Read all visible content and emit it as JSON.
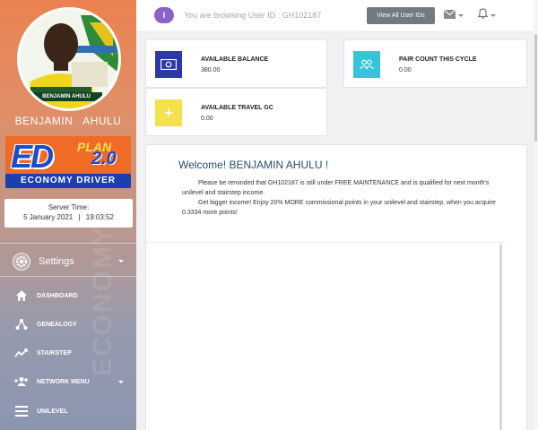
{
  "sidebar": {
    "user_name": "BENJAMIN   AHULU",
    "avatar_caption": "BENJAMIN AHULU",
    "logo": {
      "main": "ED",
      "plan": "PLAN",
      "version": "2.0",
      "tagline": "ECONOMY DRIVER"
    },
    "watermark": "ECONOMY",
    "server": {
      "label": "Server Time:",
      "date": "5 January 2021",
      "separator": "|",
      "time": "19:03:52"
    },
    "settings_label": "Settings",
    "menu": [
      {
        "label": "DASHBOARD",
        "icon": "home-icon"
      },
      {
        "label": "GENEALOGY",
        "icon": "sitemap-icon"
      },
      {
        "label": "STAIRSTEP",
        "icon": "line-chart-icon"
      },
      {
        "label": "NETWORK MENU",
        "icon": "users-plus-icon"
      },
      {
        "label": "UNILEVEL",
        "icon": "list-icon"
      }
    ]
  },
  "topbar": {
    "badge": "I",
    "browsing_text": "You are browsing User ID : GH102187",
    "view_all_button": "View All User IDs"
  },
  "cards": [
    {
      "title": "AVAILABLE BALANCE",
      "value": "380.00",
      "icon": "money-icon",
      "color": "#2d38a8"
    },
    {
      "title": "PAIR COUNT THIS CYCLE",
      "value": "0.00",
      "icon": "group-icon",
      "color": "#35c4dc"
    },
    {
      "title": "AVAILABLE TRAVEL GC",
      "value": "0.00",
      "icon": "plane-icon",
      "color": "#f5e14b"
    }
  ],
  "welcome": {
    "title": "Welcome! BENJAMIN AHULU !",
    "paragraph_1": "Please be reminded that GH102187  is still under FREE MAINTENANCE and is qualified for next month's unilevel and stairstep income.",
    "paragraph_2": "Get bigger income! Enjoy 20% MORE commissional points in your unilevel and stairstep, when you acquire 0.3334 more points!"
  }
}
